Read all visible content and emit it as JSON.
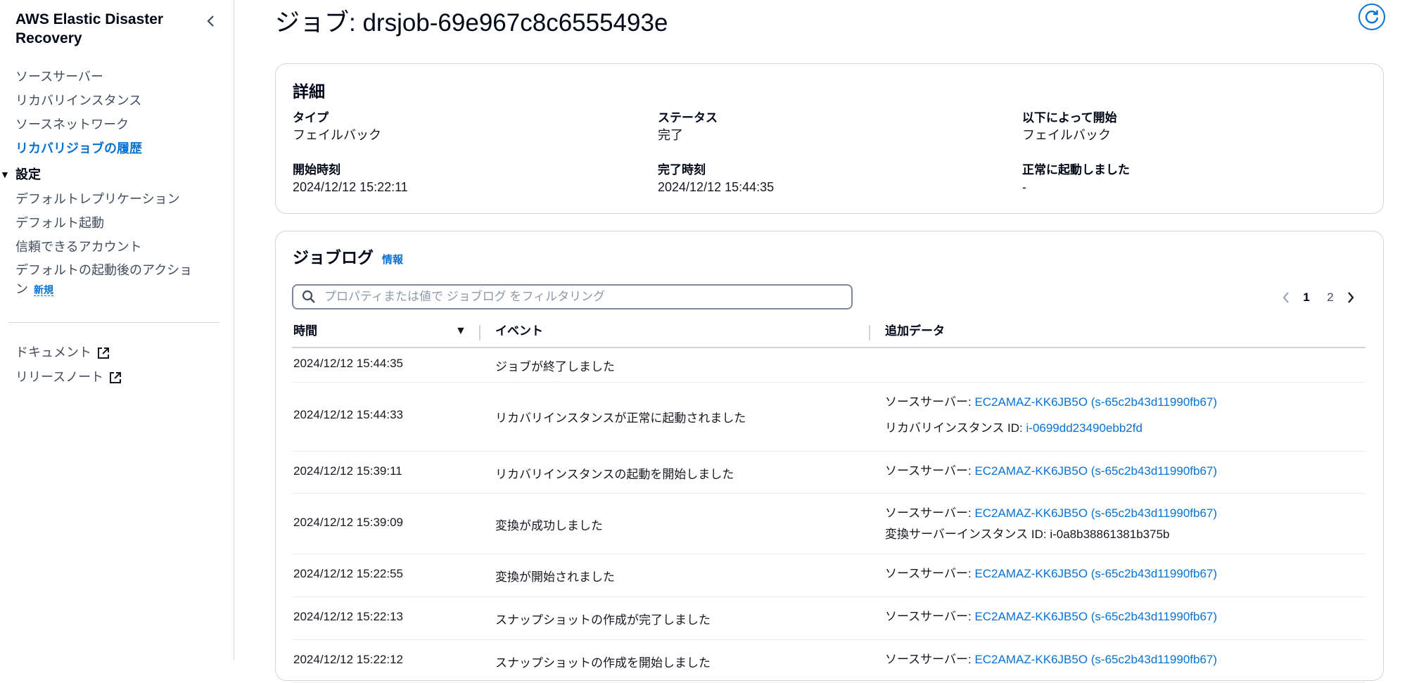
{
  "sidebar": {
    "title": "AWS Elastic Disaster Recovery",
    "nav": [
      {
        "label": "ソースサーバー"
      },
      {
        "label": "リカバリインスタンス"
      },
      {
        "label": "ソースネットワーク"
      },
      {
        "label": "リカバリジョブの履歴"
      }
    ],
    "settings": {
      "label": "設定",
      "items": [
        {
          "label": "デフォルトレプリケーション"
        },
        {
          "label": "デフォルト起動"
        },
        {
          "label": "信頼できるアカウント"
        },
        {
          "label": "デフォルトの起動後のアクション",
          "badge": "新規"
        }
      ]
    },
    "links": [
      {
        "label": "ドキュメント"
      },
      {
        "label": "リリースノート"
      }
    ]
  },
  "page": {
    "title": "ジョブ: drsjob-69e967c8c6555493e"
  },
  "details": {
    "heading": "詳細",
    "fields": [
      {
        "key": "タイプ",
        "value": "フェイルバック"
      },
      {
        "key": "ステータス",
        "value": "完了"
      },
      {
        "key": "以下によって開始",
        "value": "フェイルバック"
      },
      {
        "key": "開始時刻",
        "value": "2024/12/12 15:22:11"
      },
      {
        "key": "完了時刻",
        "value": "2024/12/12 15:44:35"
      },
      {
        "key": "正常に起動しました",
        "value": "-"
      }
    ]
  },
  "joblog": {
    "heading": "ジョブログ",
    "info": "情報",
    "search_placeholder": "プロパティまたは値で ジョブログ をフィルタリング",
    "pages": [
      "1",
      "2"
    ],
    "current_page": "1",
    "columns": {
      "time": "時間",
      "event": "イベント",
      "extra": "追加データ"
    },
    "rows": [
      {
        "time": "2024/12/12 15:44:35",
        "event": "ジョブが終了しました",
        "extra": []
      },
      {
        "time": "2024/12/12 15:44:33",
        "event": "リカバリインスタンスが正常に起動されました",
        "extra": [
          {
            "label": "ソースサーバー: ",
            "value": "EC2AMAZ-KK6JB5O (s-65c2b43d11990fb67)"
          },
          {
            "label": "リカバリインスタンス ID: ",
            "value": "i-0699dd23490ebb2fd"
          }
        ]
      },
      {
        "time": "2024/12/12 15:39:11",
        "event": "リカバリインスタンスの起動を開始しました",
        "extra": [
          {
            "label": "ソースサーバー: ",
            "value": "EC2AMAZ-KK6JB5O (s-65c2b43d11990fb67)"
          }
        ]
      },
      {
        "time": "2024/12/12 15:39:09",
        "event": "変換が成功しました",
        "extra": [
          {
            "label": "ソースサーバー: ",
            "value": "EC2AMAZ-KK6JB5O (s-65c2b43d11990fb67)"
          },
          {
            "label": "変換サーバーインスタンス ID: ",
            "value": "i-0a8b38861381b375b"
          }
        ]
      },
      {
        "time": "2024/12/12 15:22:55",
        "event": "変換が開始されました",
        "extra": [
          {
            "label": "ソースサーバー: ",
            "value": "EC2AMAZ-KK6JB5O (s-65c2b43d11990fb67)"
          }
        ]
      },
      {
        "time": "2024/12/12 15:22:13",
        "event": "スナップショットの作成が完了しました",
        "extra": [
          {
            "label": "ソースサーバー: ",
            "value": "EC2AMAZ-KK6JB5O (s-65c2b43d11990fb67)"
          }
        ]
      },
      {
        "time": "2024/12/12 15:22:12",
        "event": "スナップショットの作成を開始しました",
        "extra": [
          {
            "label": "ソースサーバー: ",
            "value": "EC2AMAZ-KK6JB5O (s-65c2b43d11990fb67)"
          }
        ]
      }
    ]
  },
  "colors": {
    "link": "#0972d3",
    "text": "#16191f",
    "border": "#d1d5db"
  },
  "icons": {
    "collapse": "chevron-left-icon",
    "refresh": "refresh-icon",
    "external": "external-link-icon",
    "search": "search-icon",
    "sort": "caret-down-icon",
    "prev": "chevron-left-icon",
    "next": "chevron-right-icon"
  }
}
